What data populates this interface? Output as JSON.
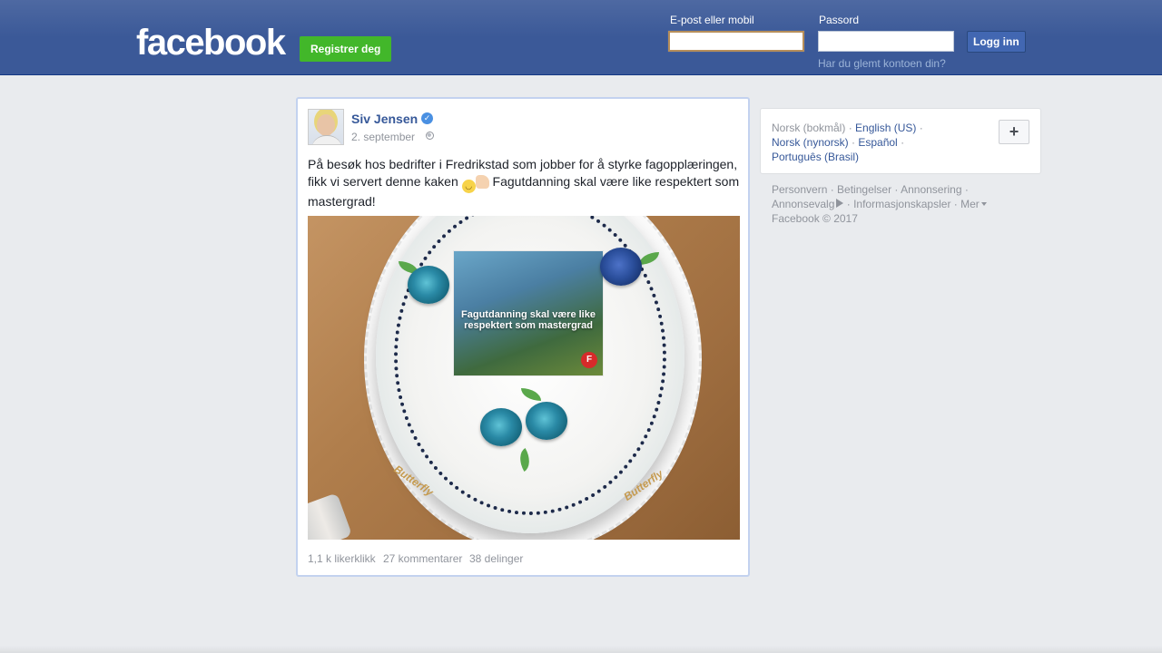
{
  "header": {
    "logo_text": "facebook",
    "register_label": "Registrer deg",
    "email_label": "E-post eller mobil",
    "email_value": "",
    "password_label": "Passord",
    "password_value": "",
    "login_label": "Logg inn",
    "forgot_label": "Har du glemt kontoen din?",
    "colors": {
      "bar": "#3b5998",
      "register": "#42b72a",
      "login": "#4267b2"
    }
  },
  "post": {
    "author": "Siv Jensen",
    "verified_icon": "verified-badge-icon",
    "date": "2. september",
    "privacy_icon": "globe-icon",
    "text_part1": "På besøk hos bedrifter i Fredrikstad som jobber for å styrke fagopplæringen, fikk vi servert denne kaken",
    "text_part2": "Fagutdanning skal være like respektert som mastergrad!",
    "emojis": [
      "grinning-emoji-icon",
      "thumbs-up-emoji-icon"
    ],
    "photo": {
      "print_text": "Fagutdanning skal være like respektert som mastergrad",
      "brand_left": "Butterfly",
      "brand_right": "Butterfly"
    },
    "stats": {
      "likes": "1,1 k likerklikk",
      "comments": "27 kommentarer",
      "shares": "38 delinger"
    }
  },
  "sidebar": {
    "languages": {
      "current": "Norsk (bokmål)",
      "english": "English (US)",
      "nynorsk": "Norsk (nynorsk)",
      "espanol": "Español",
      "portugues": "Português (Brasil)",
      "more_icon": "plus-icon"
    },
    "footer": {
      "privacy": "Personvern",
      "terms": "Betingelser",
      "advertising": "Annonsering",
      "ad_choices": "Annonsevalg",
      "cookies": "Informasjonskapsler",
      "more": "Mer",
      "copyright": "Facebook © 2017"
    }
  }
}
